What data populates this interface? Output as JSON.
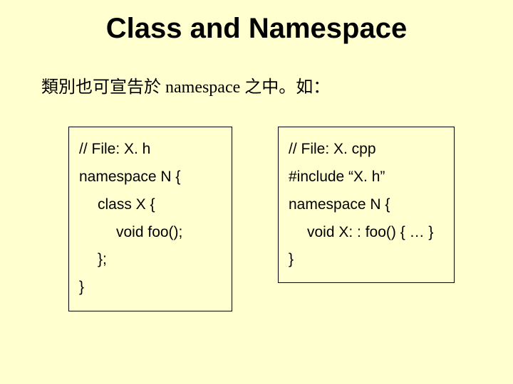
{
  "title": "Class and Namespace",
  "subtitle": "類別也可宣告於 namespace 之中。如：",
  "left": {
    "l1": "// File: X. h",
    "l2": "namespace N {",
    "l3": "class X {",
    "l4": "void foo();",
    "l5": "};",
    "l6": "}"
  },
  "right": {
    "l1": "// File: X. cpp",
    "l2": "#include “X. h”",
    "l3": "namespace N {",
    "l4": "void X: : foo() { … }",
    "l5": "}"
  }
}
